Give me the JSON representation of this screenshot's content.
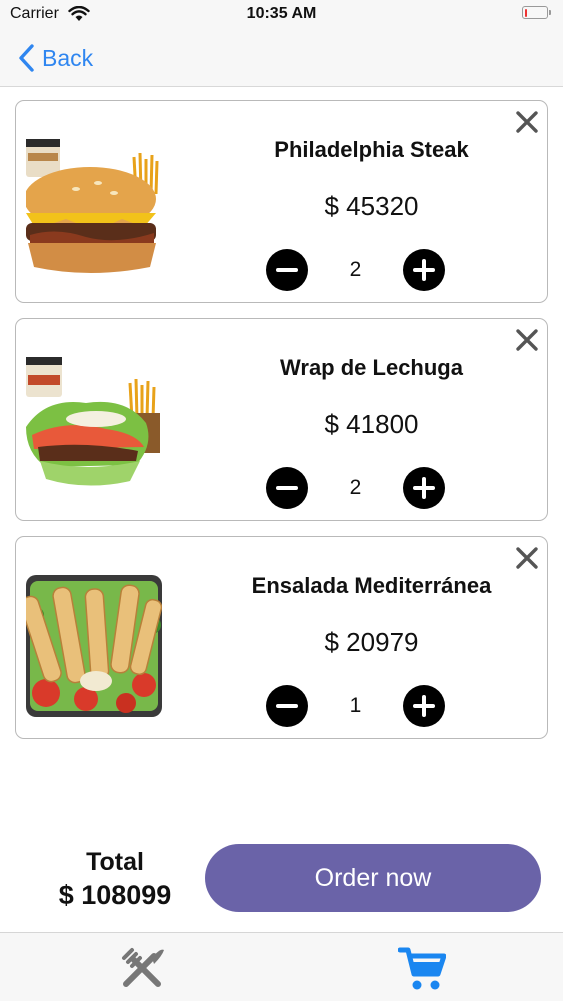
{
  "status_bar": {
    "carrier": "Carrier",
    "time": "10:35 AM"
  },
  "nav": {
    "back_label": "Back",
    "accent_color": "#2f86f0"
  },
  "cart_items": [
    {
      "name": "Philadelphia Steak",
      "price": "$ 45320",
      "quantity": "2",
      "image": "burger"
    },
    {
      "name": "Wrap de Lechuga",
      "price": "$ 41800",
      "quantity": "2",
      "image": "lettuce-wrap"
    },
    {
      "name": "Ensalada Mediterránea",
      "price": "$ 20979",
      "quantity": "1",
      "image": "salad"
    }
  ],
  "summary": {
    "total_label": "Total",
    "total_value": "$ 108099",
    "order_button": "Order now",
    "button_color": "#6a63a8"
  },
  "tab_bar": {
    "tabs": [
      {
        "icon": "fork-knife-icon",
        "active": false
      },
      {
        "icon": "cart-icon",
        "active": true,
        "color": "#1a86f0"
      }
    ]
  }
}
